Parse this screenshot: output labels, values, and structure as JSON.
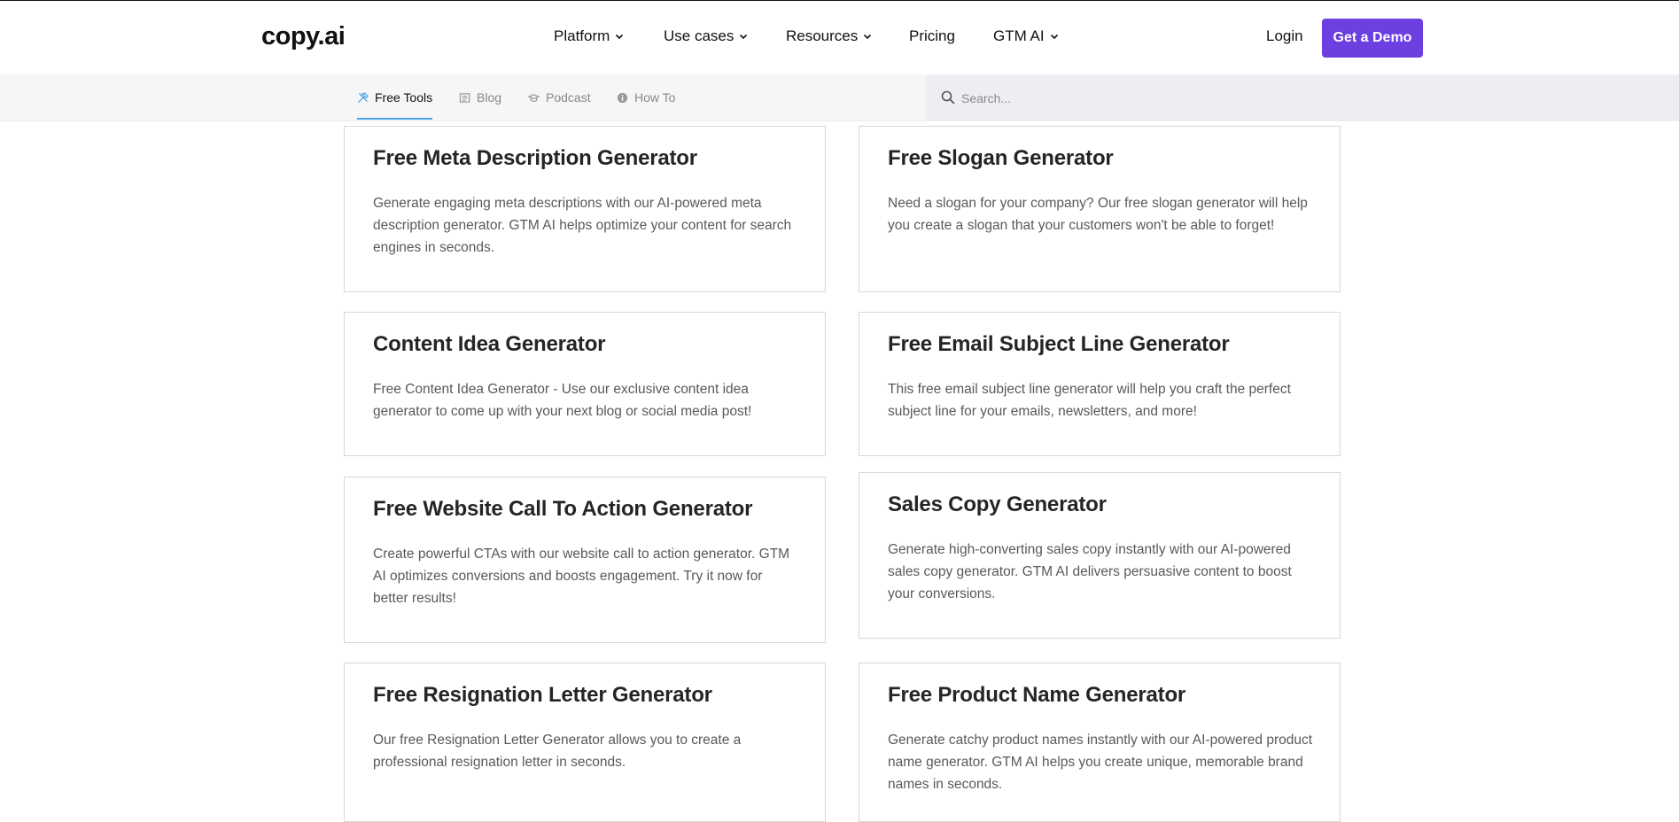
{
  "header": {
    "logo": "copy.ai",
    "nav": [
      {
        "label": "Platform",
        "dropdown": true
      },
      {
        "label": "Use cases",
        "dropdown": true
      },
      {
        "label": "Resources",
        "dropdown": true
      },
      {
        "label": "Pricing",
        "dropdown": false
      },
      {
        "label": "GTM AI",
        "dropdown": true
      }
    ],
    "login": "Login",
    "cta": "Get a Demo",
    "cta_color": "#6b3fe0"
  },
  "subnav": {
    "tabs": [
      {
        "label": "Free Tools",
        "icon": "tools-icon",
        "active": true
      },
      {
        "label": "Blog",
        "icon": "newspaper-icon",
        "active": false
      },
      {
        "label": "Podcast",
        "icon": "podcast-icon",
        "active": false
      },
      {
        "label": "How To",
        "icon": "info-icon",
        "active": false
      }
    ],
    "search_placeholder": "Search...",
    "active_color": "#4aa6e6"
  },
  "cards": [
    {
      "title": "Free Meta Description Generator",
      "description": "Generate engaging meta descriptions with our AI-powered meta description generator. GTM AI helps optimize your content for search engines in seconds."
    },
    {
      "title": "Free Slogan Generator",
      "description": "Need a slogan for your company? Our free slogan generator will help you create a slogan that your customers won't be able to forget!"
    },
    {
      "title": "Content Idea Generator",
      "description": "Free Content Idea Generator - Use our exclusive content idea generator to come up with your next blog or social media post!"
    },
    {
      "title": "Free Email Subject Line Generator",
      "description": "This free email subject line generator will help you craft the perfect subject line for your emails, newsletters, and more!"
    },
    {
      "title": "Free Website Call To Action Generator",
      "description": "Create powerful CTAs with our website call to action generator. GTM AI optimizes conversions and boosts engagement. Try it now for better results!"
    },
    {
      "title": "Sales Copy Generator",
      "description": "Generate high-converting sales copy instantly with our AI-powered sales copy generator. GTM AI delivers persuasive content to boost your conversions."
    },
    {
      "title": "Free Resignation Letter Generator",
      "description": "Our free Resignation Letter Generator allows you to create a professional resignation letter in seconds."
    },
    {
      "title": "Free Product Name Generator",
      "description": "Generate catchy product names instantly with our AI-powered product name generator. GTM AI helps you create unique, memorable brand names in seconds."
    }
  ]
}
